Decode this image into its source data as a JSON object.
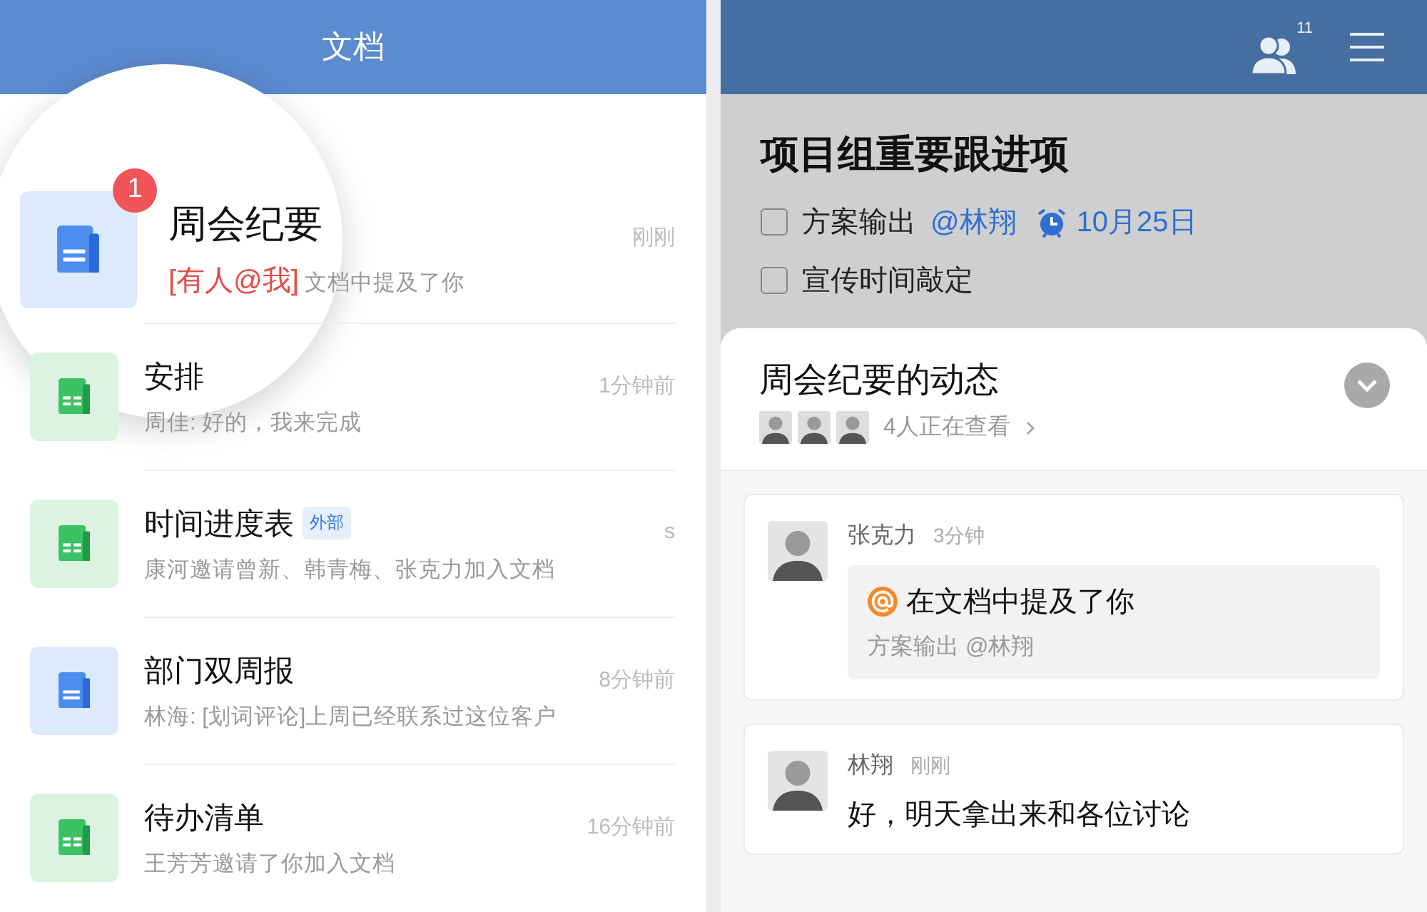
{
  "left": {
    "title": "文档",
    "docs": [
      {
        "kind": "doc",
        "magnified": true,
        "badge": "1",
        "title": "周会纪要",
        "mention": "[有人@我]",
        "preview": "文档中提及了你",
        "time": "刚刚"
      },
      {
        "kind": "sheet",
        "magnified": false,
        "title": "安排",
        "preview": "周佳: 好的，我来完成",
        "time": "1分钟前"
      },
      {
        "kind": "sheet",
        "magnified": false,
        "title": "时间进度表",
        "tag": "外部",
        "preview": "康河邀请曾新、韩青梅、张克力加入文档",
        "time": "s"
      },
      {
        "kind": "doc",
        "magnified": false,
        "title": "部门双周报",
        "preview": "林海: [划词评论]上周已经联系过这位客户",
        "time": "8分钟前"
      },
      {
        "kind": "sheet",
        "magnified": false,
        "title": "待办清单",
        "preview": "王芳芳邀请了你加入文档",
        "time": "16分钟前"
      }
    ]
  },
  "right": {
    "member_count": "11",
    "list_title": "项目组重要跟进项",
    "tasks": [
      {
        "text": "方案输出",
        "mention": "@林翔",
        "due": "10月25日",
        "checked": false
      },
      {
        "text": "宣传时间敲定",
        "checked": false
      }
    ],
    "activity": {
      "title": "周会纪要的动态",
      "viewers": "4人正在查看",
      "comments": [
        {
          "kind": "mention",
          "author": "张克力",
          "time": "3分钟",
          "headline": "在文档中提及了你",
          "quote": "方案输出 @林翔"
        },
        {
          "kind": "text",
          "author": "林翔",
          "time": "刚刚",
          "text": "好，明天拿出来和各位讨论"
        }
      ]
    }
  }
}
